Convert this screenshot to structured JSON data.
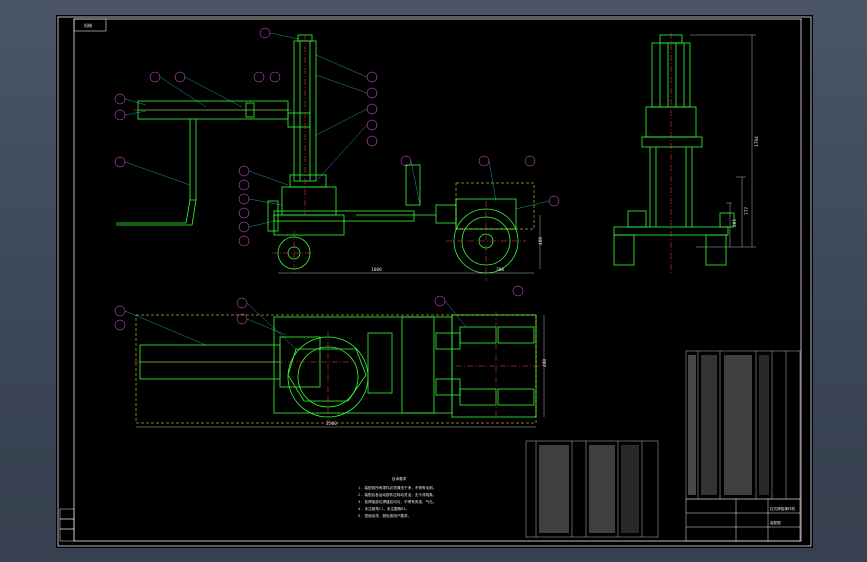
{
  "frame_tag": "机械",
  "dimensions": {
    "overall_length_side": "1080",
    "rear_length": "380",
    "overall_length_plan": "2500",
    "height_total": "1794",
    "height_mid": "777",
    "height_low": "201",
    "width_side": "480",
    "plan_width": "480"
  },
  "notes": {
    "title": "技术要求",
    "lines": [
      "1. 装配前所有零件必须清洗干净，不得有毛刺。",
      "2. 装配后各运动部件应转动灵活，无卡滞现象。",
      "3. 各焊接部位焊缝应均匀，不得有夹渣、气孔。",
      "4. 未注倒角C1，未注圆角R2。",
      "5. 表面涂漆，颜色按用户要求。"
    ]
  },
  "title_block": {
    "name": "柱式焊接操作机",
    "drawing_no": "装配图"
  }
}
